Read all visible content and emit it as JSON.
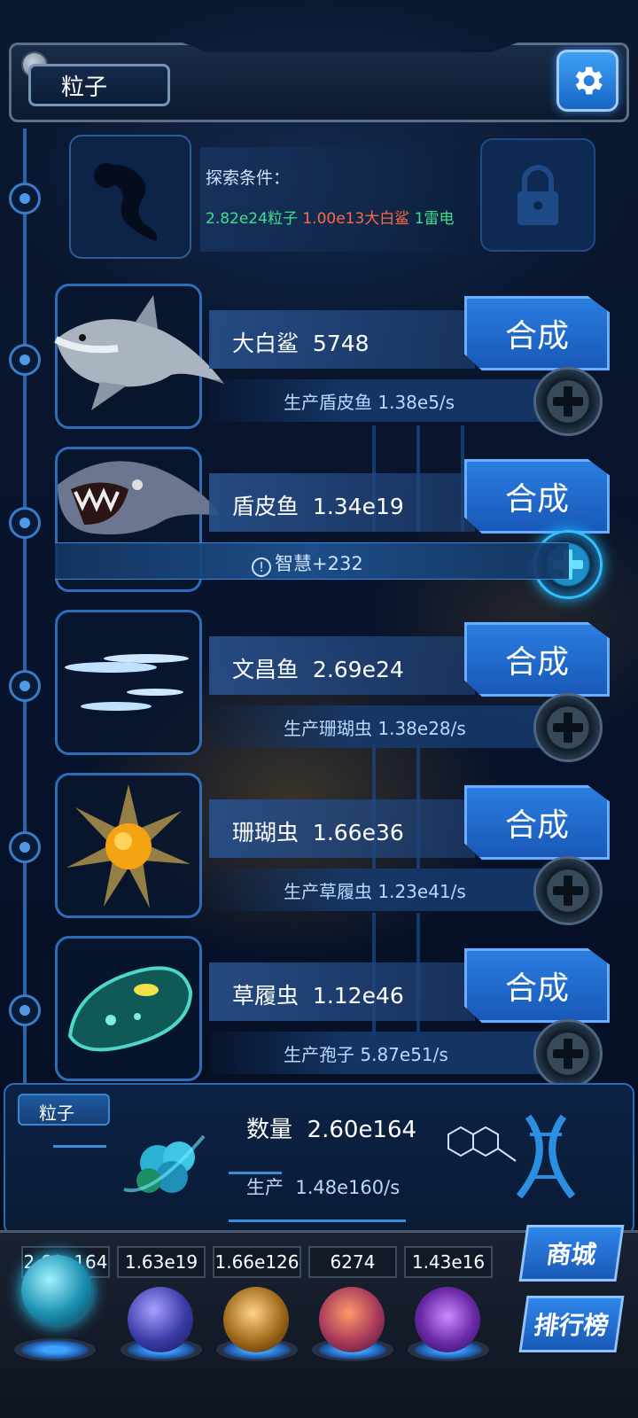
{
  "header": {
    "title": "粒子",
    "settings_icon": "gear-icon"
  },
  "locked": {
    "label": "探索条件：",
    "conditions": [
      {
        "text": "2.82e24粒子",
        "color": "#3fe08a"
      },
      {
        "text": "1.00e13大白鲨",
        "color": "#ff6b3d"
      },
      {
        "text": "1雷电",
        "color": "#3fe08a"
      }
    ],
    "icon": "lock-icon"
  },
  "creatures": [
    {
      "name": "大白鲨",
      "count": "5748",
      "production": "生产盾皮鱼  1.38e5/s",
      "button": "合成"
    },
    {
      "name": "盾皮鱼",
      "count": "1.34e19",
      "production": "",
      "button": "合成"
    },
    {
      "name": "文昌鱼",
      "count": "2.69e24",
      "production": "生产珊瑚虫  1.38e28/s",
      "button": "合成"
    },
    {
      "name": "珊瑚虫",
      "count": "1.66e36",
      "production": "生产草履虫  1.23e41/s",
      "button": "合成"
    },
    {
      "name": "草履虫",
      "count": "1.12e46",
      "production": "生产孢子  5.87e51/s",
      "button": "合成"
    }
  ],
  "wisdom": {
    "text": "智慧+232",
    "icon": "info-icon"
  },
  "bottom": {
    "tab": "粒子",
    "count_label": "数量",
    "count_value": "2.60e164",
    "prod_label": "生产",
    "prod_value": "1.48e160/s"
  },
  "resources": [
    {
      "value": "2.60e164",
      "icon": "particle-orb-icon"
    },
    {
      "value": "1.63e19",
      "icon": "lightning-orb-icon"
    },
    {
      "value": "1.66e126",
      "icon": "galaxy-orb-icon"
    },
    {
      "value": "6274",
      "icon": "brain-orb-icon"
    },
    {
      "value": "1.43e16",
      "icon": "vortex-orb-icon"
    }
  ],
  "side_buttons": {
    "shop": "商城",
    "rank": "排行榜"
  }
}
